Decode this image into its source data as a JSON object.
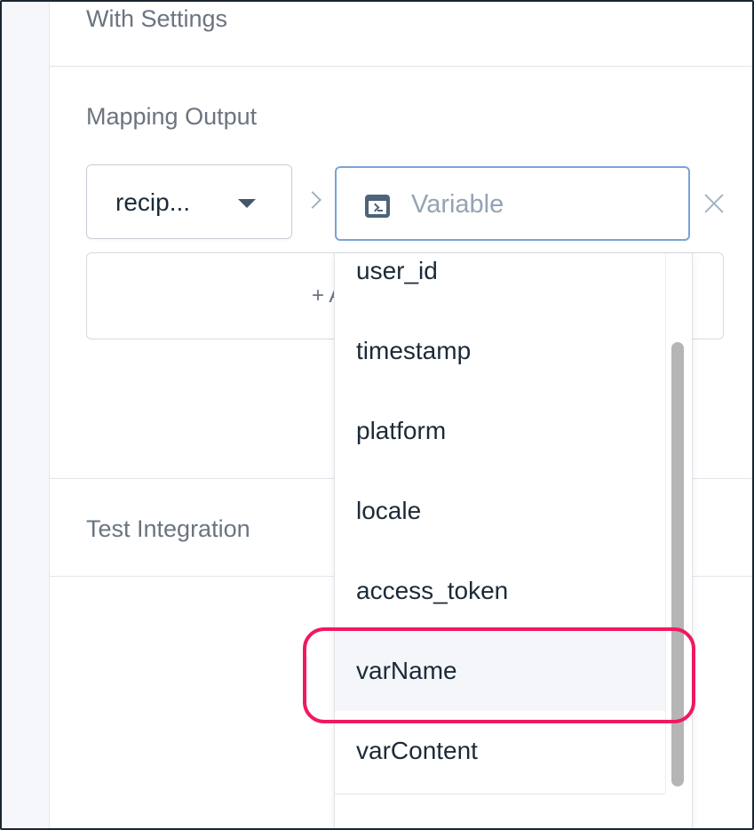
{
  "sections": {
    "with_settings": "With Settings",
    "mapping_output": "Mapping Output",
    "test_integration": "Test Integration"
  },
  "mapping": {
    "source_value": "recip...",
    "variable_placeholder": "Variable",
    "add_label": "+ A"
  },
  "dropdown": {
    "items": [
      "user_id",
      "timestamp",
      "platform",
      "locale",
      "access_token",
      "varName",
      "varContent"
    ],
    "highlighted": "varName"
  },
  "colors": {
    "highlight_ring": "#f0195f",
    "input_focus_border": "#7aa3d6"
  },
  "icons": {
    "caret": "caret-down-icon",
    "arrow": "chevron-right-icon",
    "variable": "terminal-variable-icon",
    "clear": "close-icon"
  }
}
